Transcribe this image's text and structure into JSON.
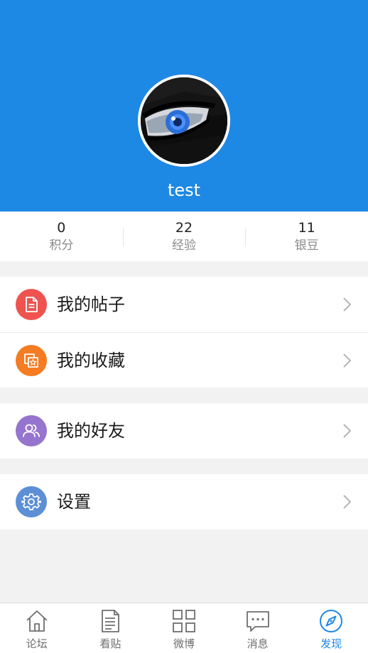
{
  "profile": {
    "username": "test"
  },
  "stats": [
    {
      "value": "0",
      "label": "积分"
    },
    {
      "value": "22",
      "label": "经验"
    },
    {
      "value": "11",
      "label": "银豆"
    }
  ],
  "menu": {
    "my_posts": {
      "label": "我的帖子",
      "icon": "document-icon",
      "color": "#ef5350"
    },
    "my_favorites": {
      "label": "我的收藏",
      "icon": "favorites-icon",
      "color": "#f57c22"
    },
    "my_friends": {
      "label": "我的好友",
      "icon": "friends-icon",
      "color": "#9575cd"
    },
    "settings": {
      "label": "设置",
      "icon": "gear-icon",
      "color": "#5c8fd6"
    }
  },
  "tabbar": [
    {
      "label": "论坛",
      "icon": "home-icon",
      "active": false
    },
    {
      "label": "看贴",
      "icon": "posts-icon",
      "active": false
    },
    {
      "label": "微博",
      "icon": "grid-icon",
      "active": false
    },
    {
      "label": "消息",
      "icon": "message-icon",
      "active": false
    },
    {
      "label": "发现",
      "icon": "compass-icon",
      "active": true
    }
  ],
  "colors": {
    "accent": "#1e88e5",
    "tab_inactive": "#6e6e6e"
  }
}
